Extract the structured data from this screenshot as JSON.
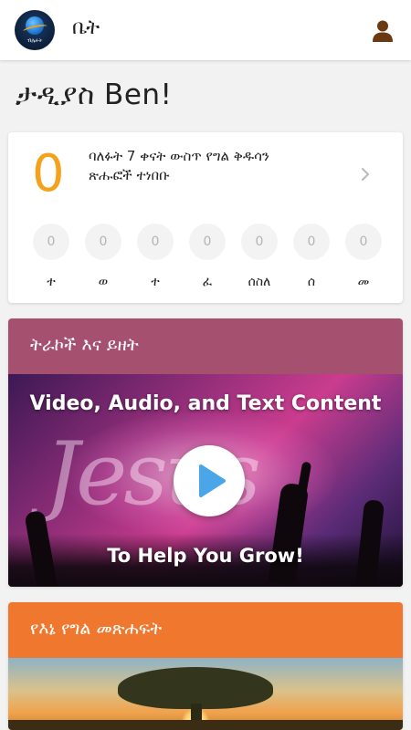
{
  "appbar": {
    "title": "ቤት",
    "logo_text": "ብሌሩት",
    "profile_icon": "user-icon"
  },
  "greeting": "ታዲያስ Ben!",
  "stats": {
    "count": "0",
    "description": "ባለፉት 7 ቀናት ውስጥ የግል ቅዱሳን ጽሑፎች ተነበቡ",
    "days": [
      {
        "value": "0",
        "label": "ተ"
      },
      {
        "value": "0",
        "label": "ወ"
      },
      {
        "value": "0",
        "label": "ተ"
      },
      {
        "value": "0",
        "label": "ፈ"
      },
      {
        "value": "0",
        "label": "ሰስለ"
      },
      {
        "value": "0",
        "label": "ሰ"
      },
      {
        "value": "0",
        "label": "መ"
      }
    ]
  },
  "resources": {
    "title": "ትራኮች እና ይዘት",
    "banner_top": "Video, Audio, and Text Content",
    "banner_bottom": "To Help You Grow!"
  },
  "journal": {
    "title": "የእኔ የግል መጽሐፍት"
  },
  "colors": {
    "accent_orange": "#f4a21c",
    "resources_header": "#a5506f",
    "journal_header": "#f0782e"
  }
}
